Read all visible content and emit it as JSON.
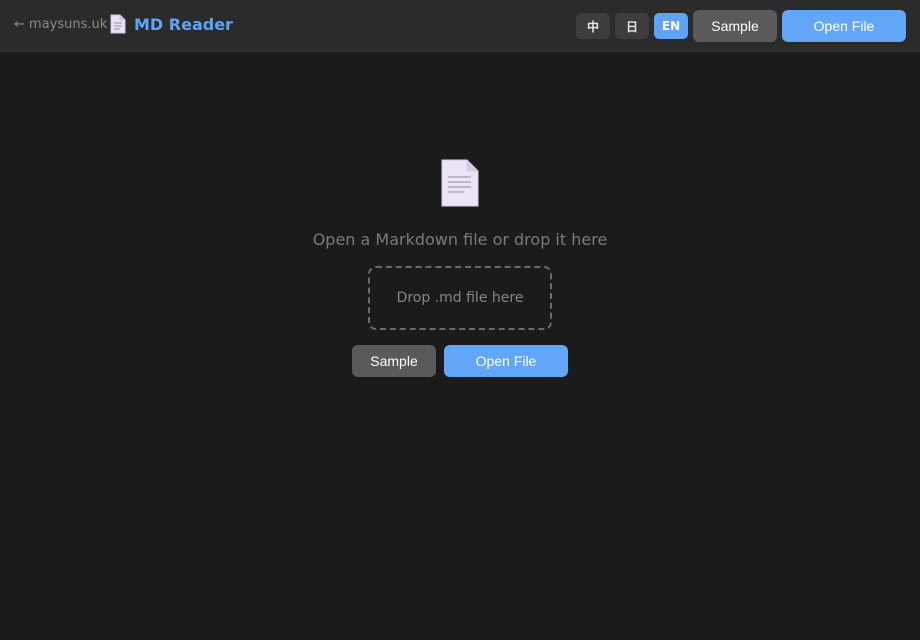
{
  "header": {
    "back_link": "← maysuns.uk",
    "app_title": "MD Reader",
    "app_icon": "document-icon",
    "languages": [
      {
        "label": "中",
        "active": false
      },
      {
        "label": "日",
        "active": false
      },
      {
        "label": "EN",
        "active": true
      }
    ],
    "sample_label": "Sample",
    "open_file_label": "Open File"
  },
  "empty_state": {
    "icon": "document-icon",
    "message": "Open a Markdown file or drop it here",
    "dropzone_label": "Drop .md file here",
    "sample_label": "Sample",
    "open_file_label": "Open File"
  },
  "colors": {
    "accent": "#62a6f8",
    "background": "#1b1b1b",
    "header_background": "#2b2b2b",
    "secondary_button": "#5a5a5a"
  }
}
